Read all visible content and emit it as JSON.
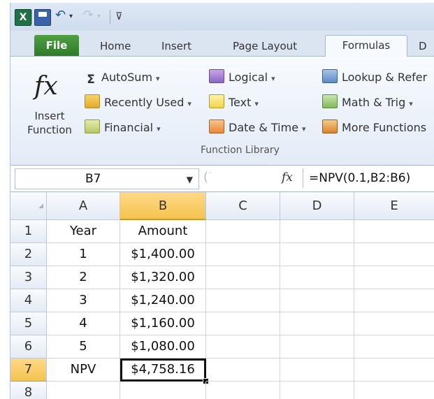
{
  "qat": {
    "app_icon_letter": "X"
  },
  "tabs": [
    {
      "label": "File"
    },
    {
      "label": "Home"
    },
    {
      "label": "Insert"
    },
    {
      "label": "Page Layout"
    },
    {
      "label": "Formulas"
    },
    {
      "label": "D"
    }
  ],
  "ribbon": {
    "insert_function": {
      "icon": "fx",
      "line1": "Insert",
      "line2": "Function"
    },
    "col1": [
      {
        "icon": "sigma-icon",
        "glyph": "Σ",
        "label": "AutoSum"
      },
      {
        "icon": "star-icon",
        "label": "Recently Used"
      },
      {
        "icon": "book-icon",
        "label": "Financial"
      }
    ],
    "col2": [
      {
        "icon": "question-book-icon",
        "label": "Logical"
      },
      {
        "icon": "text-icon",
        "label": "Text"
      },
      {
        "icon": "clock-icon",
        "label": "Date & Time"
      }
    ],
    "col3": [
      {
        "icon": "magnifier-book-icon",
        "label": "Lookup & Refer"
      },
      {
        "icon": "theta-book-icon",
        "label": "Math & Trig"
      },
      {
        "icon": "books-icon",
        "label": "More Functions"
      }
    ],
    "group_label": "Function Library",
    "colors": {
      "accent": "#2b579a",
      "file_tab": "#3c8c35",
      "selected_header": "#f5c34f"
    }
  },
  "formula_bar": {
    "name_box": "B7",
    "fx": "fx",
    "formula": "=NPV(0.1,B2:B6)"
  },
  "grid": {
    "columns": [
      "A",
      "B",
      "C",
      "D",
      "E"
    ],
    "rows": [
      {
        "num": "1",
        "a": "Year",
        "b": "Amount"
      },
      {
        "num": "2",
        "a": "1",
        "b": "$1,400.00"
      },
      {
        "num": "3",
        "a": "2",
        "b": "$1,320.00"
      },
      {
        "num": "4",
        "a": "3",
        "b": "$1,240.00"
      },
      {
        "num": "5",
        "a": "4",
        "b": "$1,160.00"
      },
      {
        "num": "6",
        "a": "5",
        "b": "$1,080.00"
      },
      {
        "num": "7",
        "a": "NPV",
        "b": "$4,758.16"
      },
      {
        "num": "8",
        "a": "",
        "b": ""
      }
    ]
  }
}
